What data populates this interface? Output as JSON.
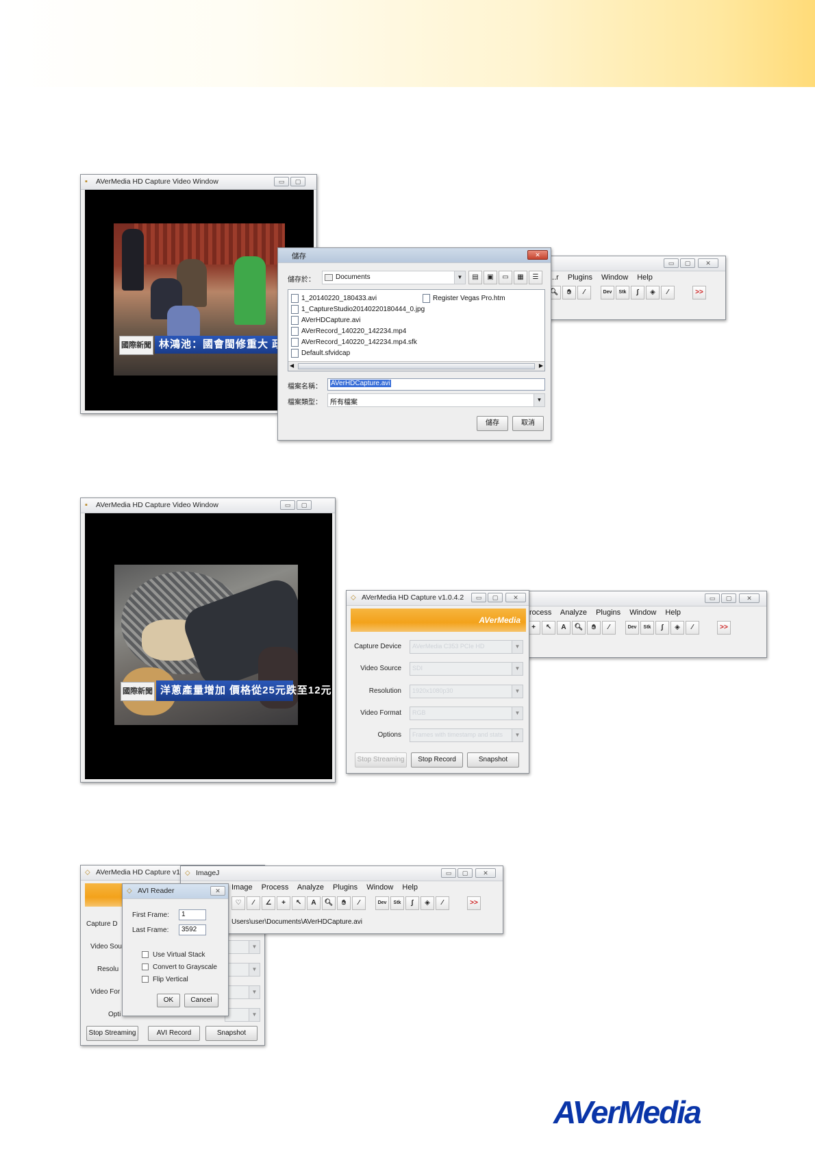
{
  "capture_window_title": "AVerMedia HD Capture Video Window",
  "save_dialog": {
    "title": "儲存",
    "save_in_label": "儲存於：",
    "folder": "Documents",
    "files": [
      "1_20140220_180433.avi",
      "1_CaptureStudio20140220180444_0.jpg",
      "AVerHDCapture.avi",
      "AVerRecord_140220_142234.mp4",
      "AVerRecord_140220_142234.mp4.sfk",
      "Default.sfvidcap",
      "Register Vegas Pro.htm"
    ],
    "filename_label": "檔案名稱：",
    "filename_value": "AVerHDCapture.avi",
    "filetype_label": "檔案類型：",
    "filetype_value": "所有檔案",
    "save_button": "儲存",
    "cancel_button": "取消"
  },
  "imagej": {
    "title": "ImageJ",
    "menus_partial_1": [
      "...r",
      "Plugins",
      "Window",
      "Help"
    ],
    "menus_partial_2": [
      "rocess",
      "Analyze",
      "Plugins",
      "Window",
      "Help"
    ],
    "menus_full": [
      "Image",
      "Process",
      "Analyze",
      "Plugins",
      "Window",
      "Help"
    ],
    "status_path": "Users\\user\\Documents\\AVerHDCapture.avi",
    "tool_dev": "Dev",
    "tool_stk": "Stk",
    "tool_more": ">>"
  },
  "tv": {
    "channel_logo": "國際新聞",
    "ticker_1": "林鴻池：國會閩修重大 政院應提議送",
    "ticker_2": "洋蔥產量增加 價格從25元跌至12元"
  },
  "capture_panel": {
    "title_full": "AVerMedia HD Capture v1.0.4.2",
    "title_short": "AVerMedia HD Capture v1",
    "brand": "AVerMedia",
    "capture_device_label": "Capture Device",
    "video_source_label": "Video Source",
    "resolution_label": "Resolution",
    "video_format_label": "Video Format",
    "options_label": "Options",
    "capture_device_value": "AVerMedia C353 PCIe HD",
    "video_source_value": "SDI",
    "resolution_value": "1920x1080p30",
    "video_format_value": "RGB",
    "options_value": "Frames with timestamp and stats",
    "stop_streaming": "Stop Streaming",
    "stop_record": "Stop Record",
    "avi_record": "AVI Record",
    "snapshot": "Snapshot",
    "label_capture_cut": "Capture D",
    "label_video_source_cut": "Video Sou",
    "label_resolution_cut": "Resolu",
    "label_video_format_cut": "Video For",
    "label_options_cut": "Opti"
  },
  "avi_reader": {
    "title": "AVI Reader",
    "first_frame_label": "First Frame:",
    "first_frame_value": "1",
    "last_frame_label": "Last Frame:",
    "last_frame_value": "3592",
    "use_virtual_stack": "Use Virtual Stack",
    "convert_grayscale": "Convert to Grayscale",
    "flip_vertical": "Flip Vertical",
    "ok": "OK",
    "cancel": "Cancel"
  },
  "footer_logo": "AVerMedia",
  "colors": {
    "accent_orange": "#f3a21b",
    "logo_blue": "#0a35a8"
  }
}
